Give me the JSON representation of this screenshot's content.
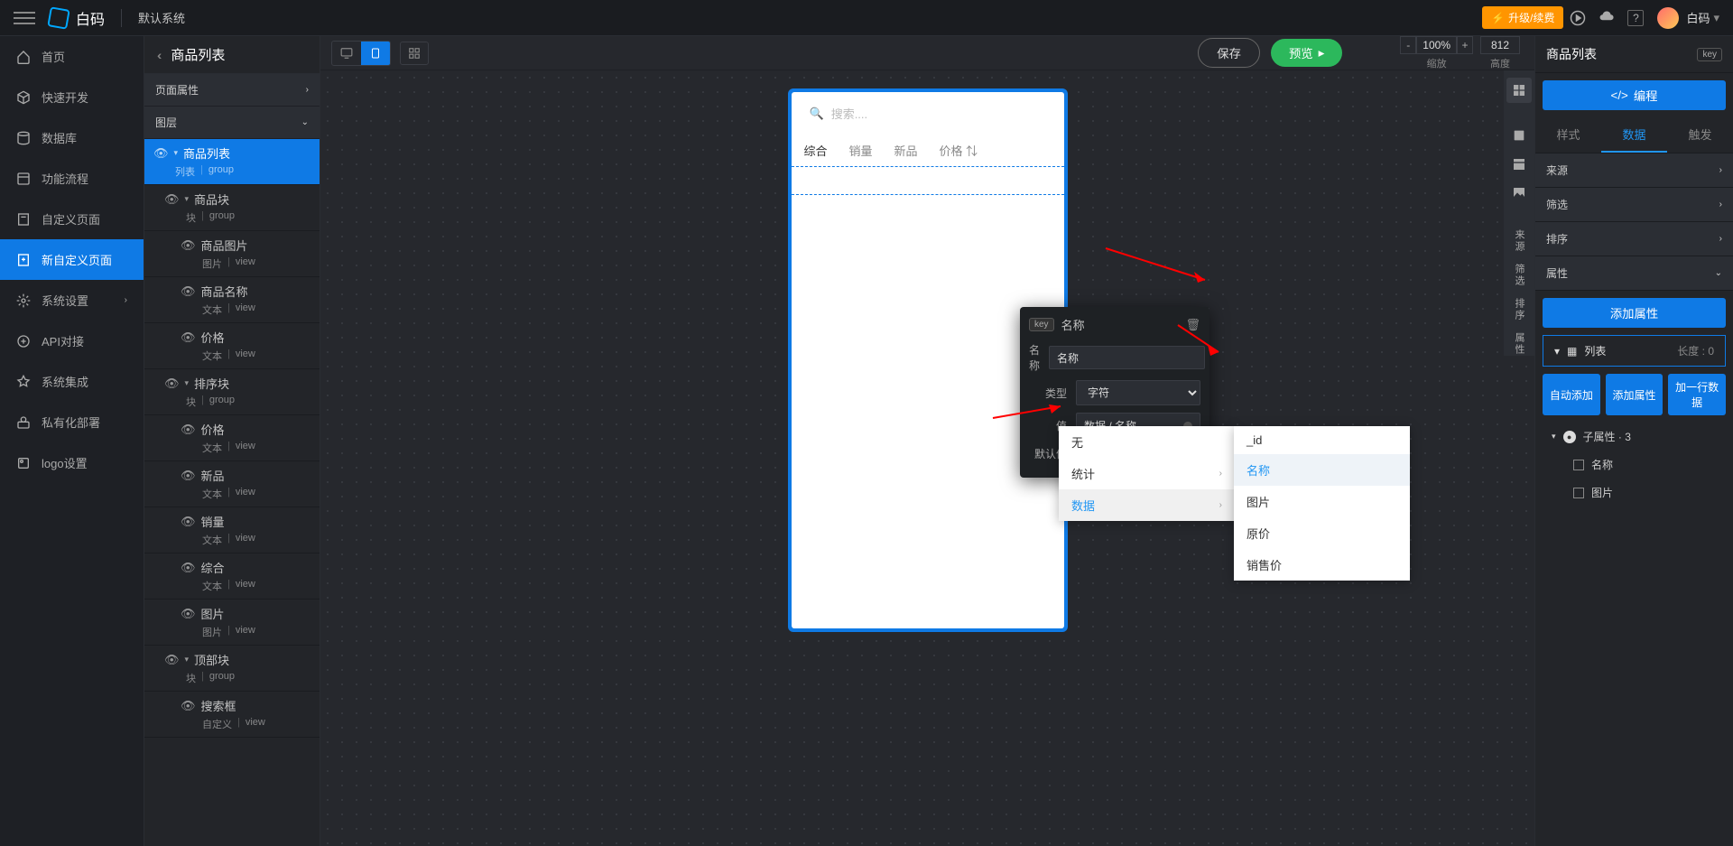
{
  "topbar": {
    "logo_text": "白码",
    "system_name": "默认系统",
    "upgrade": "升级/续费",
    "username": "白码"
  },
  "leftnav": [
    {
      "label": "首页",
      "icon": "home"
    },
    {
      "label": "快速开发",
      "icon": "cube"
    },
    {
      "label": "数据库",
      "icon": "db"
    },
    {
      "label": "功能流程",
      "icon": "flow"
    },
    {
      "label": "自定义页面",
      "icon": "page"
    },
    {
      "label": "新自定义页面",
      "icon": "newpage",
      "active": true
    },
    {
      "label": "系统设置",
      "icon": "gear",
      "chev": true
    },
    {
      "label": "API对接",
      "icon": "api"
    },
    {
      "label": "系统集成",
      "icon": "integrate"
    },
    {
      "label": "私有化部署",
      "icon": "deploy"
    },
    {
      "label": "logo设置",
      "icon": "logo"
    }
  ],
  "page_title": "商品列表",
  "sections": {
    "page_attr": "页面属性",
    "layers": "图层"
  },
  "layers": [
    {
      "name": "商品列表",
      "sub1": "列表",
      "sub2": "group",
      "selected": true,
      "indent": 0,
      "caret": true
    },
    {
      "name": "商品块",
      "sub1": "块",
      "sub2": "group",
      "indent": 1,
      "caret": true
    },
    {
      "name": "商品图片",
      "sub1": "图片",
      "sub2": "view",
      "indent": 2
    },
    {
      "name": "商品名称",
      "sub1": "文本",
      "sub2": "view",
      "indent": 2
    },
    {
      "name": "价格",
      "sub1": "文本",
      "sub2": "view",
      "indent": 2
    },
    {
      "name": "排序块",
      "sub1": "块",
      "sub2": "group",
      "indent": 1,
      "caret": true
    },
    {
      "name": "价格",
      "sub1": "文本",
      "sub2": "view",
      "indent": 2
    },
    {
      "name": "新品",
      "sub1": "文本",
      "sub2": "view",
      "indent": 2
    },
    {
      "name": "销量",
      "sub1": "文本",
      "sub2": "view",
      "indent": 2
    },
    {
      "name": "综合",
      "sub1": "文本",
      "sub2": "view",
      "indent": 2
    },
    {
      "name": "图片",
      "sub1": "图片",
      "sub2": "view",
      "indent": 2
    },
    {
      "name": "顶部块",
      "sub1": "块",
      "sub2": "group",
      "indent": 1,
      "caret": true
    },
    {
      "name": "搜索框",
      "sub1": "自定义",
      "sub2": "view",
      "indent": 2
    }
  ],
  "canvas": {
    "save": "保存",
    "preview": "预览",
    "zoom": "100%",
    "zoom_label": "缩放",
    "height_val": "812",
    "height_label": "高度",
    "search_placeholder": "搜索....",
    "tabs": [
      "综合",
      "销量",
      "新品",
      "价格"
    ]
  },
  "strip_labels": [
    "来源",
    "筛选",
    "排序",
    "属性"
  ],
  "inspector": {
    "title": "商品列表",
    "key": "key",
    "code_btn": "编程",
    "tabs": [
      "样式",
      "数据",
      "触发"
    ],
    "sections": [
      "来源",
      "筛选",
      "排序",
      "属性"
    ],
    "add_attr": "添加属性",
    "list_label": "列表",
    "list_len_label": "长度 :",
    "list_len": "0",
    "auto_add": "自动添加",
    "add_attr2": "添加属性",
    "add_row": "加一行数据",
    "sub_attr": "子属性 · 3",
    "children": [
      "名称",
      "图片"
    ]
  },
  "popup": {
    "key": "key",
    "title": "名称",
    "name_label": "名称",
    "name_value": "名称",
    "type_label": "类型",
    "type_value": "字符",
    "value_label": "值",
    "value_value": "数据 / 名称",
    "default_label": "默认值"
  },
  "menu": {
    "items": [
      {
        "label": "无"
      },
      {
        "label": "统计",
        "sub": true
      },
      {
        "label": "数据",
        "sub": true,
        "active": true
      }
    ]
  },
  "submenu": [
    {
      "label": "_id"
    },
    {
      "label": "名称",
      "highlighted": true
    },
    {
      "label": "图片"
    },
    {
      "label": "原价"
    },
    {
      "label": "销售价"
    }
  ]
}
